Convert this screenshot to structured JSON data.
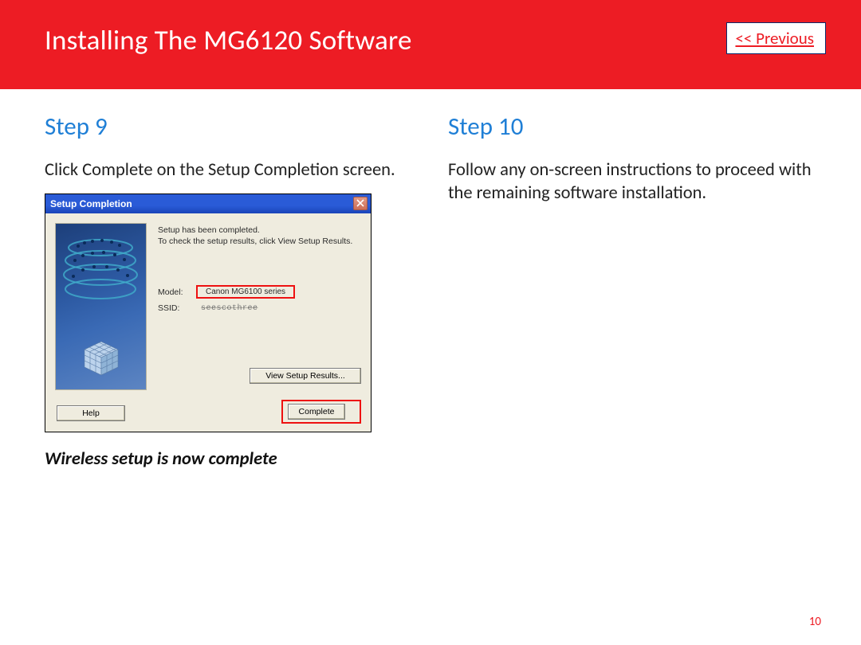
{
  "header": {
    "title": "Installing The MG6120 Software",
    "previous_link": " << Previous"
  },
  "left": {
    "heading": "Step 9",
    "body": "Click Complete on the Setup Completion screen.",
    "complete_note": "Wireless setup is now complete"
  },
  "right": {
    "heading": "Step 10",
    "body": "Follow any on-screen instructions to proceed with the remaining software installation."
  },
  "dialog": {
    "title": "Setup Completion",
    "line1": "Setup has been completed.",
    "line2": "To check the setup results, click View Setup Results.",
    "model_label": "Model:",
    "model_value": "Canon MG6100 series",
    "ssid_label": "SSID:",
    "ssid_value": "seescothree",
    "btn_view": "View Setup Results...",
    "btn_help": "Help",
    "btn_complete": "Complete"
  },
  "page_number": "10"
}
